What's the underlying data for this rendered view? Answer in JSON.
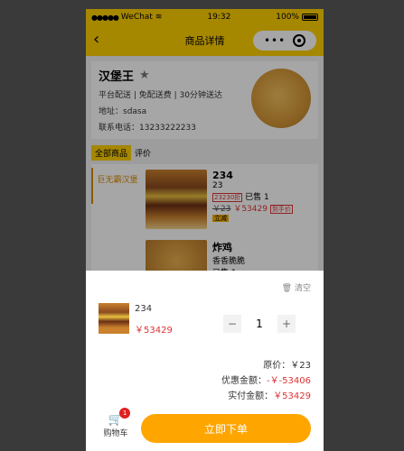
{
  "status": {
    "carrier": "WeChat",
    "time": "19:32",
    "battery": "100%"
  },
  "nav": {
    "title": "商品详情"
  },
  "shop": {
    "name": "汉堡王",
    "tags": "平台配送 | 免配送费 | 30分钟送达",
    "address": "地址：sdasa",
    "phone": "联系电话：13233222233"
  },
  "tabs": [
    "全部商品",
    "评价"
  ],
  "menu": {
    "category": "巨无霸汉堡",
    "items": [
      {
        "title": "234",
        "sub": "23",
        "badge": "23230折",
        "sold": "已售 1",
        "old_price": "￥23",
        "new_price": "￥53429",
        "tag": "到手价",
        "tag2": "立减"
      },
      {
        "title": "炸鸡",
        "sub": "香香脆脆",
        "badge": "",
        "sold": "已售 1"
      }
    ]
  },
  "cart_sheet": {
    "clear": "清空",
    "item_name": "234",
    "item_price": "￥53429",
    "quantity": "1",
    "minus": "−",
    "plus": "+",
    "original_label": "原价：",
    "original_value": "￥23",
    "discount_label": "优惠金额：",
    "discount_value": "-￥-53406",
    "pay_label": "实付金额：",
    "pay_value": "￥53429",
    "cart_label": "购物车",
    "cart_count": "1",
    "order_button": "立即下单"
  }
}
